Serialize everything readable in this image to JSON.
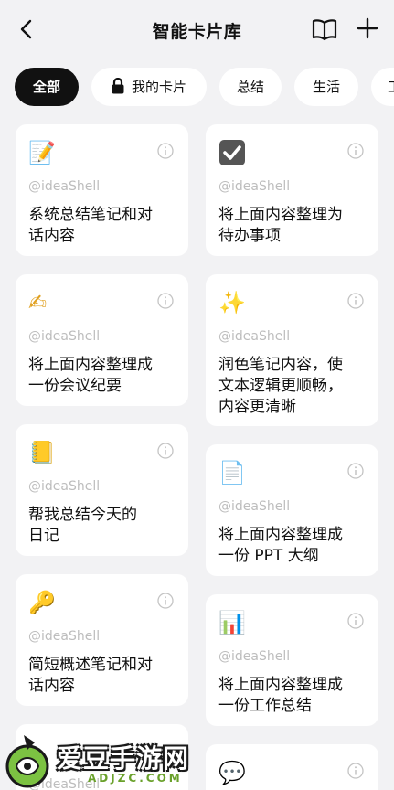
{
  "header": {
    "title": "智能卡片库"
  },
  "filters": [
    {
      "label": "全部",
      "active": true
    },
    {
      "label": "我的卡片",
      "locked": true
    },
    {
      "label": "总结"
    },
    {
      "label": "生活"
    },
    {
      "label": "工"
    }
  ],
  "cards": [
    {
      "emoji": "📝",
      "author": "@ideaShell",
      "text": [
        "系统总结笔记和对",
        "话内容"
      ]
    },
    {
      "emoji": "✔",
      "author": "@ideaShell",
      "text": [
        "将上面内容整理为",
        "待办事项"
      ]
    },
    {
      "emoji": "✍",
      "author": "@ideaShell",
      "text": [
        "将上面内容整理成",
        "一份会议纪要"
      ]
    },
    {
      "emoji": "✨",
      "author": "@ideaShell",
      "text": [
        "润色笔记内容，使",
        "文本逻辑更顺畅，",
        "内容更清晰"
      ]
    },
    {
      "emoji": "📒",
      "author": "@ideaShell",
      "text": [
        "帮我总结今天的",
        "日记"
      ]
    },
    {
      "emoji": "📄",
      "author": "@ideaShell",
      "text": [
        "将上面内容整理成",
        "一份 PPT 大纲"
      ]
    },
    {
      "emoji": "🔑",
      "author": "@ideaShell",
      "text": [
        "简短概述笔记和对",
        "话内容"
      ]
    },
    {
      "emoji": "📊",
      "author": "@ideaShell",
      "text": [
        "将上面内容整理成",
        "一份工作总结"
      ]
    },
    {
      "emoji": "",
      "author": "@ideaShell",
      "text": []
    },
    {
      "emoji": "💬",
      "author": "",
      "text": []
    }
  ],
  "watermark": {
    "brand": "爱豆手游网",
    "site": "ADJZC.COM"
  }
}
